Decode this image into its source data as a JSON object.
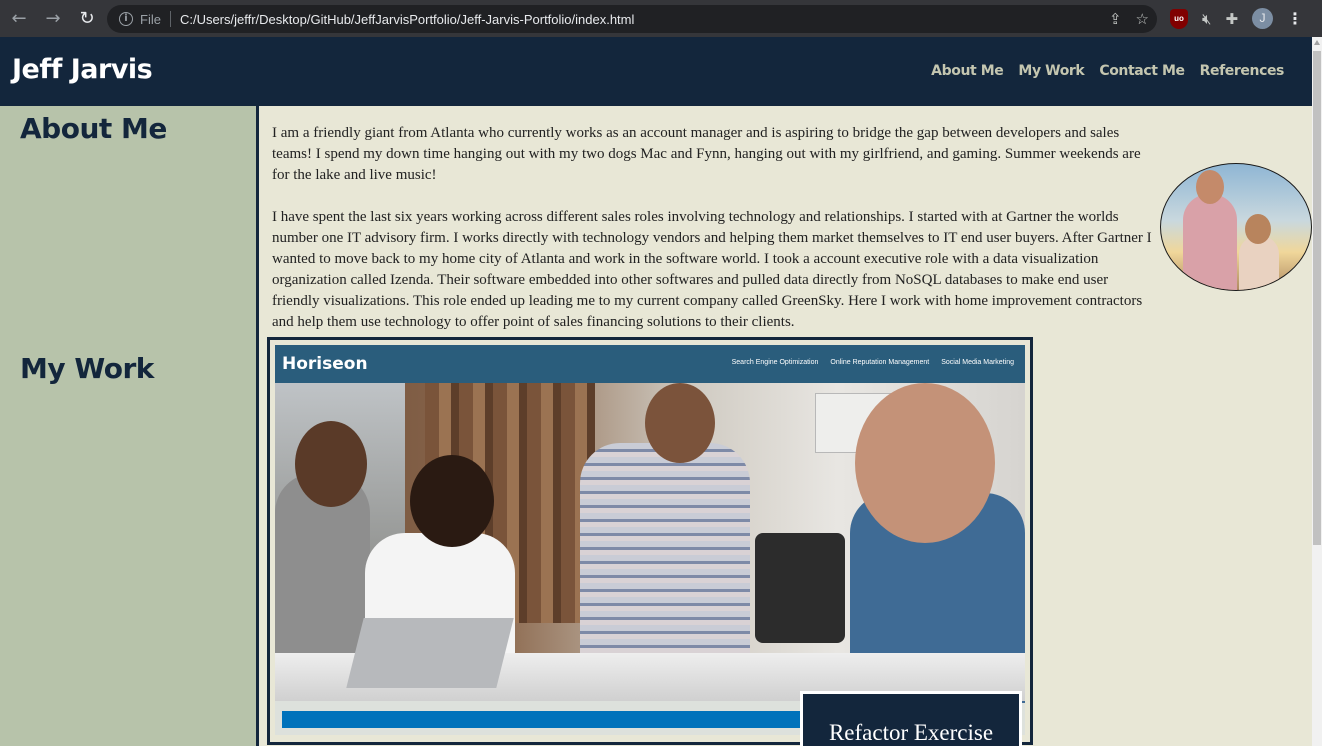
{
  "browser": {
    "file_label": "File",
    "url": "C:/Users/jeffr/Desktop/GitHub/JeffJarvisPortfolio/Jeff-Jarvis-Portfolio/index.html",
    "profile_initial": "J",
    "ublock_label": "uo"
  },
  "site": {
    "title": "Jeff Jarvis",
    "nav": [
      "About Me",
      "My Work",
      "Contact Me",
      "References"
    ]
  },
  "sections": {
    "about_heading": "About Me",
    "work_heading": "My Work"
  },
  "about": {
    "paragraphs": [
      "I am a friendly giant from Atlanta who currently works as an account manager and is aspiring to bridge the gap between developers and sales teams! I spend my down time hanging out with my two dogs Mac and Fynn, hanging out with my girlfriend, and gaming. Summer weekends are for the lake and live music!",
      "I have spent the last six years working across different sales roles involving technology and relationships. I started with at Gartner the worlds number one IT advisory firm. I works directly with technology vendors and helping them market themselves to IT end user buyers. After Gartner I wanted to move back to my home city of Atlanta and work in the software world. I took a account executive role with a data visualization organization called Izenda. Their software embedded into other softwares and pulled data directly from NoSQL databases to make end user friendly visualizations. This role ended up leading me to my current company called GreenSky. Here I work with home improvement contractors and help them use technology to offer point of sales financing solutions to their clients."
    ]
  },
  "work": {
    "project_label": "Refactor Exercise",
    "screenshot": {
      "logo": "Horiseon",
      "nav": [
        "Search Engine Optimization",
        "Online Reputation Management",
        "Social Media Marketing"
      ]
    }
  }
}
